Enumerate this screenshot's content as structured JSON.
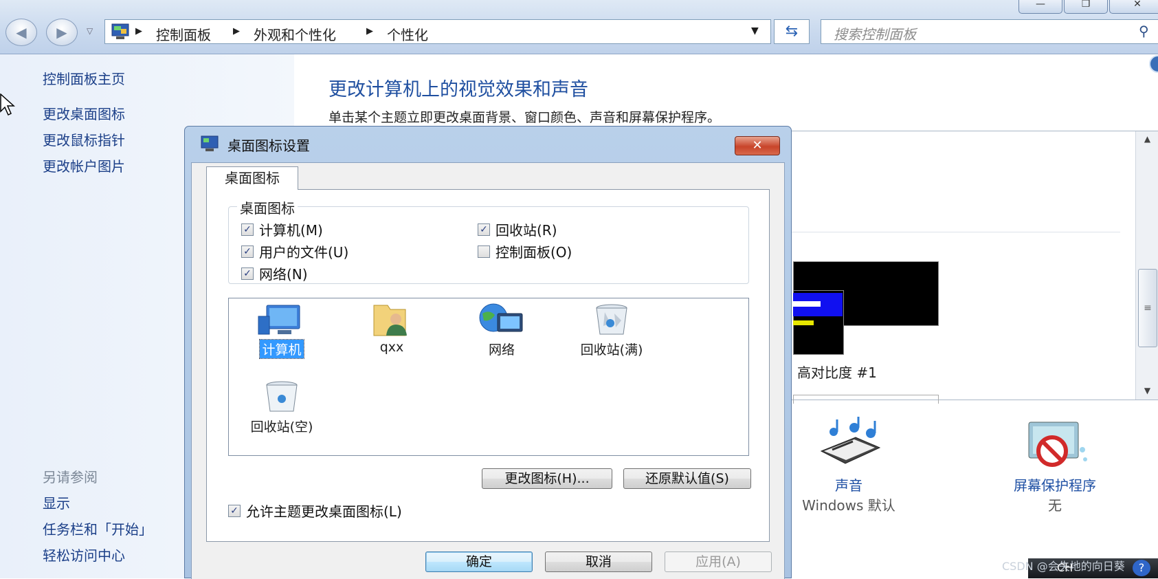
{
  "window": {
    "minimize_glyph": "—",
    "maximize_glyph": "❐",
    "close_glyph": "✕"
  },
  "address": {
    "breadcrumbs": [
      "控制面板",
      "外观和个性化",
      "个性化"
    ],
    "search_placeholder": "搜索控制面板"
  },
  "sidebar": {
    "home": "控制面板主页",
    "links": [
      "更改桌面图标",
      "更改鼠标指针",
      "更改帐户图片"
    ],
    "see_also_heading": "另请参阅",
    "see_also": [
      "显示",
      "任务栏和「开始」",
      "轻松访问中心"
    ]
  },
  "main": {
    "title": "更改计算机上的视觉效果和声音",
    "subtitle": "单击某个主题立即更改桌面背景、窗口颜色、声音和屏幕保护程序。",
    "theme_label": "高对比度 #1",
    "bottom_items": [
      {
        "label": "声音",
        "value": "Windows 默认"
      },
      {
        "label": "屏幕保护程序",
        "value": "无"
      }
    ]
  },
  "dialog": {
    "title": "桌面图标设置",
    "tab": "桌面图标",
    "group_title": "桌面图标",
    "checkboxes": [
      {
        "label": "计算机(M)",
        "checked": true
      },
      {
        "label": "回收站(R)",
        "checked": true
      },
      {
        "label": "用户的文件(U)",
        "checked": true
      },
      {
        "label": "控制面板(O)",
        "checked": false
      },
      {
        "label": "网络(N)",
        "checked": true
      }
    ],
    "icons": [
      {
        "label": "计算机",
        "icon": "computer-icon",
        "selected": true
      },
      {
        "label": "qxx",
        "icon": "user-folder-icon",
        "selected": false
      },
      {
        "label": "网络",
        "icon": "network-icon",
        "selected": false
      },
      {
        "label": "回收站(满)",
        "icon": "recycle-bin-full-icon",
        "selected": false
      },
      {
        "label": "回收站(空)",
        "icon": "recycle-bin-empty-icon",
        "selected": false
      }
    ],
    "change_icon_button": "更改图标(H)...",
    "restore_default_button": "还原默认值(S)",
    "allow_themes": {
      "label": "允许主题更改桌面图标(L)",
      "checked": true
    },
    "ok_button": "确定",
    "cancel_button": "取消",
    "apply_button": "应用(A)"
  },
  "watermark": "CSDN @会失地的向日葵",
  "taskbar": {
    "lang": "CH"
  },
  "colors": {
    "link": "#1b3f88",
    "title_blue": "#1f4fa0",
    "selection": "#3399ff"
  }
}
